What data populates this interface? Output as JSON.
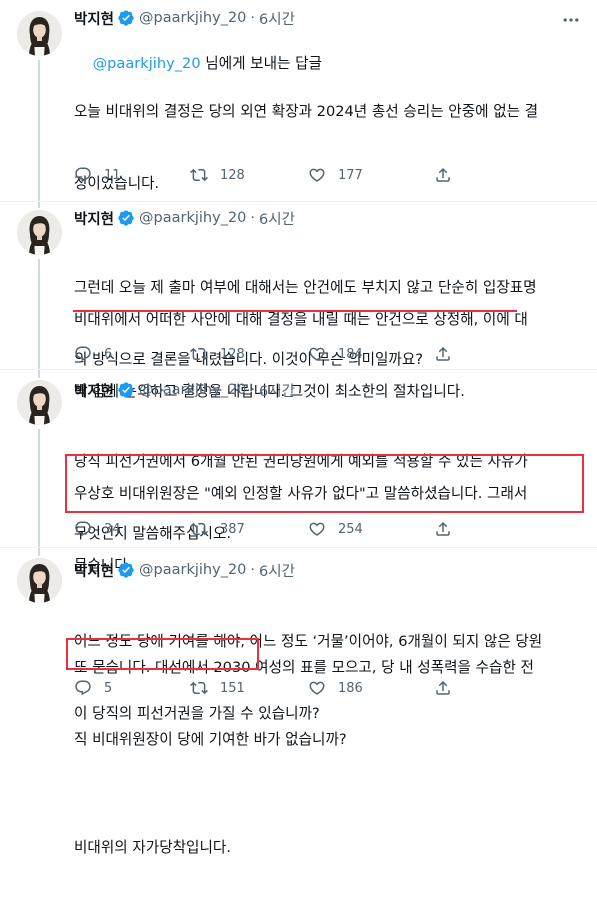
{
  "tweets": [
    {
      "name": "박지현",
      "handle": "@paarkjihy_20",
      "dot": "·",
      "time": "6시간",
      "reply_mention": "@paarkjihy_20",
      "reply_suffix": " 님에게 보내는 답글",
      "lines": [
        "오늘 비대위의 결정은 당의 외연 확장과 2024년 총선 승리는 안중에 없는 결",
        "정이었습니다.",
        "",
        "비대위에서 어떠한 사안에 대해 결정을 내릴 때는 안건으로 상정해, 이에 대",
        "해 함께 논의하고 결정을 내립니다. 그것이 최소한의 절차입니다."
      ],
      "replies": "11",
      "retweets": "128",
      "likes": "177"
    },
    {
      "name": "박지현",
      "handle": "@paarkjihy_20",
      "dot": "·",
      "time": "6시간",
      "lines": [
        "그런데 오늘 제 출마 여부에 대해서는 안건에도 부치지 않고 단순히 입장표명",
        "의 방식으로 결론을 내렸습니다. 이것이 무슨 의미일까요?",
        "",
        "우상호 비대위원장은 \"예외 인정할 사유가 없다\"고 말씀하셨습니다. 그래서",
        "묻습니다."
      ],
      "replies": "6",
      "retweets": "128",
      "likes": "184"
    },
    {
      "name": "박지현",
      "handle": "@paarkjihy_20",
      "dot": "·",
      "time": "6시간",
      "lines": [
        "당직 피선거권에서 6개월 안된 권리당원에게 예외를 적용할 수 있는 사유가",
        "무엇인지 말씀해주십시오.",
        "",
        "또 묻습니다. 대선에서 2030 여성의 표를 모으고, 당 내 성폭력을 수습한 전",
        "직 비대위원장이 당에 기여한 바가 없습니까?"
      ],
      "replies": "34",
      "retweets": "387",
      "likes": "254"
    },
    {
      "name": "박지현",
      "handle": "@paarkjihy_20",
      "dot": "·",
      "time": "6시간",
      "lines": [
        "어느 정도 당에 기여를 해야, 어느 정도 ‘거물’이어야, 6개월이 되지 않은 당원",
        "이 당직의 피선거권을 가질 수 있습니까?",
        "",
        "비대위의 자가당착입니다."
      ],
      "replies": "5",
      "retweets": "151",
      "likes": "186"
    }
  ],
  "colors": {
    "verified": "#1d9bf0",
    "highlight": "#e8313f",
    "muted": "#536471"
  },
  "icons": [
    "verified-badge-icon",
    "more-icon",
    "reply-icon",
    "retweet-icon",
    "like-icon",
    "share-icon"
  ]
}
